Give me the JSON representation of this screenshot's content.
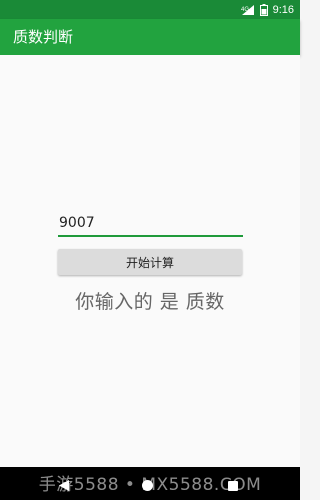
{
  "status_bar": {
    "signal_label": "4G",
    "time": "9:16"
  },
  "app_bar": {
    "title": "质数判断"
  },
  "main": {
    "input_value": "9007",
    "button_label": "开始计算",
    "result_text": "你输入的 是 质数"
  },
  "watermark": {
    "text": "手游5588 • MX5588.COM"
  },
  "colors": {
    "status_bar": "#1a8a37",
    "app_bar": "#22a33f",
    "accent": "#1f9a3a"
  },
  "icons": [
    "signal-icon",
    "battery-icon",
    "nav-back-icon",
    "nav-home-icon",
    "nav-recent-icon"
  ]
}
